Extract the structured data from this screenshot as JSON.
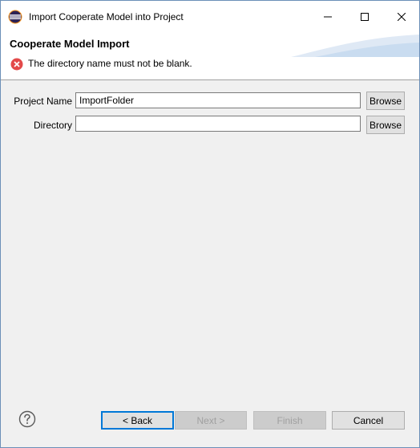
{
  "window": {
    "title": "Import Cooperate Model into Project"
  },
  "banner": {
    "heading": "Cooperate Model Import",
    "error_message": "The directory name must not be blank."
  },
  "form": {
    "project_name_label": "Project Name",
    "project_name_value": "ImportFolder",
    "directory_label": "Directory",
    "directory_value": "",
    "browse_label": "Browse"
  },
  "footer": {
    "back_label": "< Back",
    "next_label": "Next >",
    "finish_label": "Finish",
    "cancel_label": "Cancel"
  },
  "colors": {
    "error": "#e34a4a",
    "focus_border": "#0078d7",
    "disabled_text": "#a0a0a0"
  }
}
